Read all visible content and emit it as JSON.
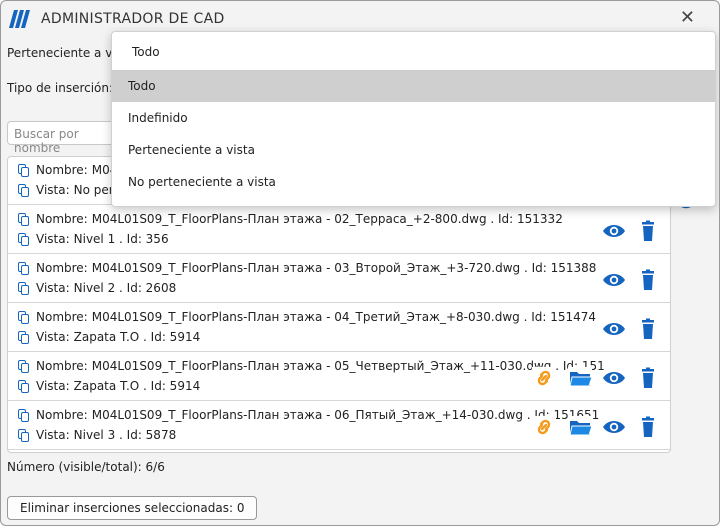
{
  "window": {
    "title": "ADMINISTRADOR DE CAD",
    "close_glyph": "✕"
  },
  "filters": {
    "view_label": "Perteneciente a vista",
    "insert_type_label": "Tipo de inserción:",
    "search_placeholder": "Buscar por nombre"
  },
  "dropdown": {
    "header": "Todo",
    "options": [
      "Todo",
      "Indefinido",
      "Perteneciente a vista",
      "No perteneciente a vista"
    ],
    "selected_index": 0
  },
  "rows": [
    {
      "name_label": "Nombre:",
      "name": "M04",
      "view_label": "Vista:",
      "view": "No pert",
      "icons": [
        "link-icon",
        "folder-icon",
        "eye-icon",
        "trash-icon"
      ]
    },
    {
      "name_label": "Nombre:",
      "name": "M04L01S09_T_FloorPlans-План этажа - 02_Терраса_+2-800.dwg . Id:  151332",
      "view_label": "Vista:",
      "view": "Nivel 1 . Id:  356",
      "icons": [
        "eye-icon",
        "trash-icon"
      ]
    },
    {
      "name_label": "Nombre:",
      "name": "M04L01S09_T_FloorPlans-План этажа - 03_Второй_Этаж_+3-720.dwg . Id:  151388",
      "view_label": "Vista:",
      "view": "Nivel 2 . Id:  2608",
      "icons": [
        "eye-icon",
        "trash-icon"
      ]
    },
    {
      "name_label": "Nombre:",
      "name": "M04L01S09_T_FloorPlans-План этажа - 04_Третий_Этаж_+8-030.dwg . Id:  151474",
      "view_label": "Vista:",
      "view": "Zapata T.O . Id:  5914",
      "icons": [
        "eye-icon",
        "trash-icon"
      ]
    },
    {
      "name_label": "Nombre:",
      "name": "M04L01S09_T_FloorPlans-План этажа - 05_Четвертый_Этаж_+11-030.dwg . Id:  151",
      "view_label": "Vista:",
      "view": "Zapata T.O . Id:  5914",
      "icons": [
        "link-icon",
        "folder-icon",
        "eye-icon",
        "trash-icon"
      ]
    },
    {
      "name_label": "Nombre:",
      "name": "M04L01S09_T_FloorPlans-План этажа - 06_Пятый_Этаж_+14-030.dwg . Id:  151651",
      "view_label": "Vista:",
      "view": "Nivel 3 . Id:  5878",
      "icons": [
        "link-icon",
        "folder-icon",
        "eye-icon",
        "trash-icon"
      ]
    }
  ],
  "status": "Número (visible/total): 6/6",
  "delete_button": "Eliminar inserciones seleccionadas: 0",
  "colors": {
    "accent": "#1565c0",
    "link": "#f59b1c",
    "selected_option": "#cfcfcf"
  }
}
